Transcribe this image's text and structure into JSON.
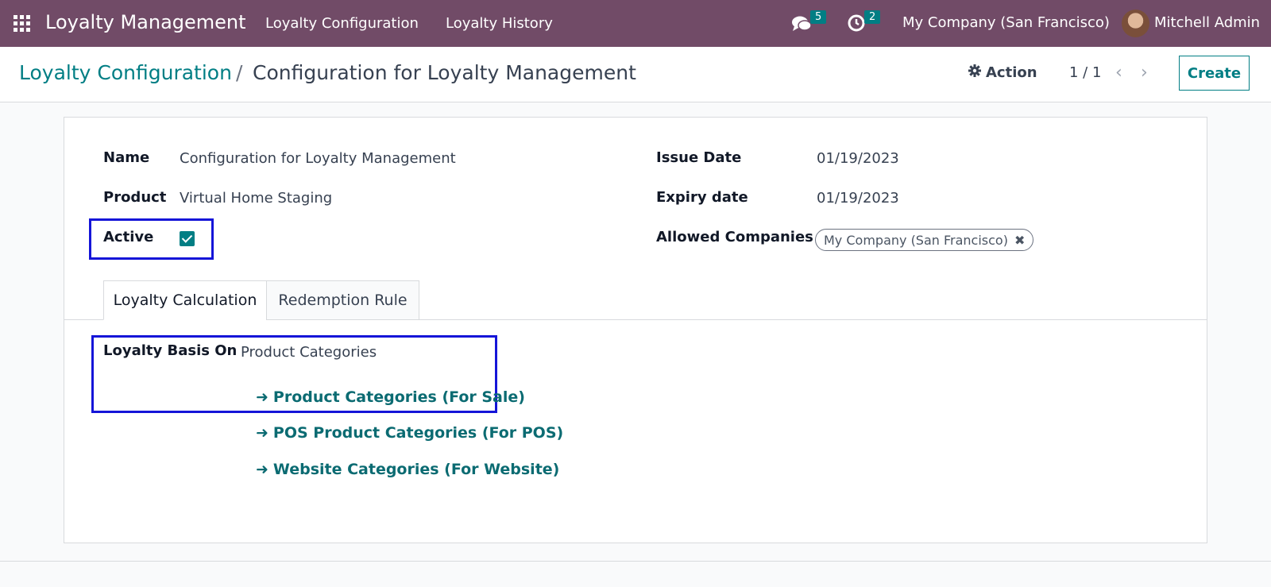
{
  "navbar": {
    "brand": "Loyalty Management",
    "menu": [
      "Loyalty Configuration",
      "Loyalty History"
    ],
    "messages_count": "5",
    "activities_count": "2",
    "company": "My Company (San Francisco)",
    "user": "Mitchell Admin"
  },
  "breadcrumb": {
    "parent": "Loyalty Configuration",
    "separator": "/",
    "current": "Configuration for Loyalty Management"
  },
  "controls": {
    "action_label": "Action",
    "pager": "1 / 1",
    "create_label": "Create"
  },
  "form": {
    "name_label": "Name",
    "name_value": "Configuration for Loyalty Management",
    "product_label": "Product",
    "product_value": "Virtual Home Staging",
    "active_label": "Active",
    "active_checked": true,
    "issue_date_label": "Issue Date",
    "issue_date_value": "01/19/2023",
    "expiry_date_label": "Expiry date",
    "expiry_date_value": "01/19/2023",
    "allowed_companies_label": "Allowed Companies",
    "allowed_companies": [
      "My Company (San Francisco)"
    ]
  },
  "tabs": [
    "Loyalty Calculation",
    "Redemption Rule"
  ],
  "loyalty": {
    "basis_label": "Loyalty Basis On",
    "basis_value": "Product Categories",
    "links": [
      "Product Categories (For Sale)",
      "POS Product Categories (For POS)",
      "Website Categories (For Website)"
    ]
  },
  "colors": {
    "navbar": "#714b67",
    "accent": "#017e84",
    "highlight": "#1515d8"
  }
}
